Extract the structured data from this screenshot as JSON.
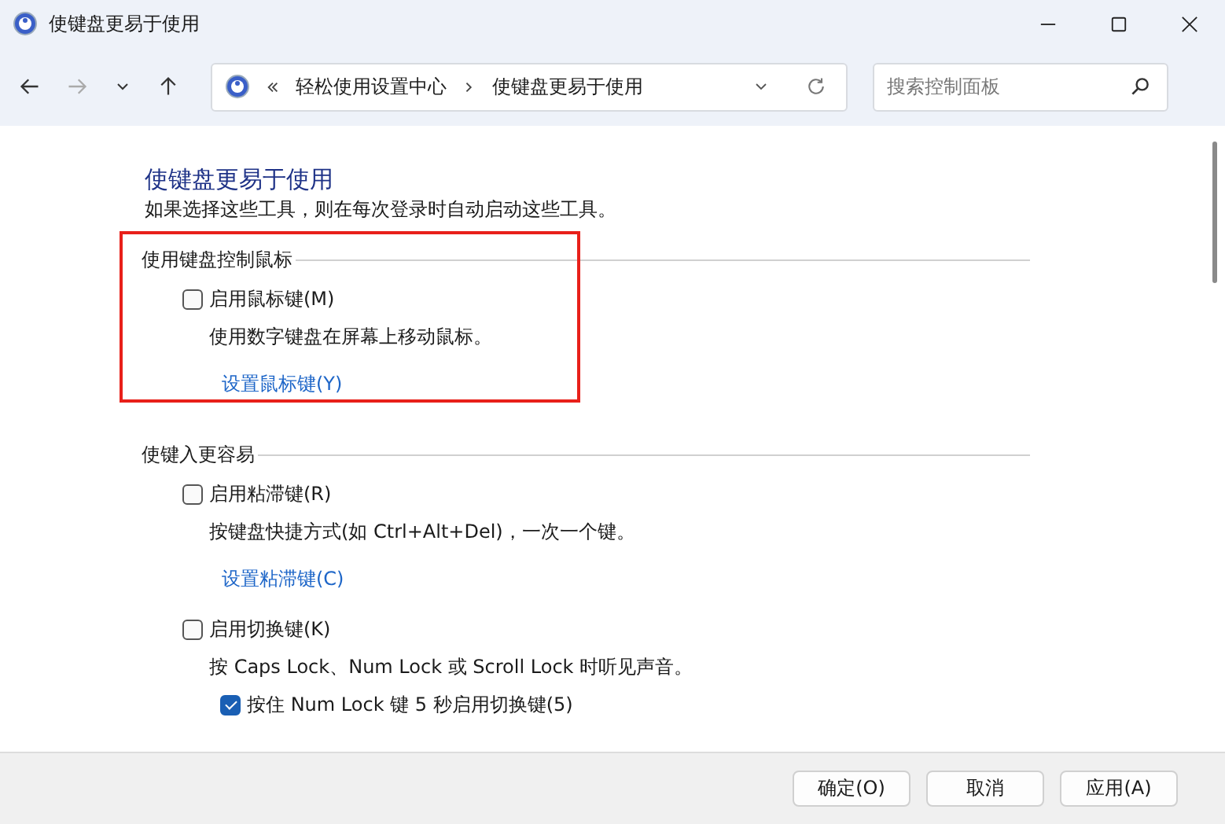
{
  "window": {
    "title": "使键盘更易于使用"
  },
  "address": {
    "path": [
      "轻松使用设置中心",
      "使键盘更易于使用"
    ]
  },
  "search": {
    "placeholder": "搜索控制面板"
  },
  "page": {
    "heading": "使键盘更易于使用",
    "intro": "如果选择这些工具，则在每次登录时自动启动这些工具。",
    "sections": [
      {
        "title": "使用键盘控制鼠标",
        "highlighted": true,
        "items": [
          {
            "kind": "checkbox",
            "label": "启用鼠标键(M)",
            "checked": false
          },
          {
            "kind": "description",
            "text": "使用数字键盘在屏幕上移动鼠标。"
          },
          {
            "kind": "link",
            "text": "设置鼠标键(Y)"
          }
        ]
      },
      {
        "title": "使键入更容易",
        "highlighted": false,
        "items": [
          {
            "kind": "checkbox",
            "label": "启用粘滞键(R)",
            "checked": false
          },
          {
            "kind": "description",
            "text": "按键盘快捷方式(如 Ctrl+Alt+Del)，一次一个键。"
          },
          {
            "kind": "link",
            "text": "设置粘滞键(C)"
          },
          {
            "kind": "checkbox",
            "label": "启用切换键(K)",
            "checked": false
          },
          {
            "kind": "description",
            "text": "按 Caps Lock、Num Lock 或 Scroll Lock 时听见声音。"
          },
          {
            "kind": "subcheckbox",
            "label": "按住 Num Lock 键 5 秒启用切换键(5)",
            "checked": true
          }
        ]
      }
    ]
  },
  "buttons": [
    "确定(O)",
    "取消",
    "应用(A)"
  ]
}
